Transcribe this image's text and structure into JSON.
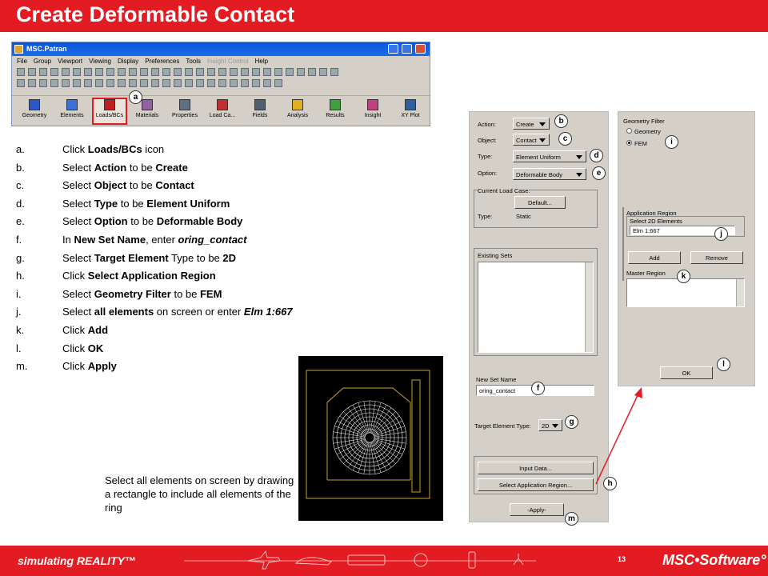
{
  "slide": {
    "title": "Create Deformable Contact",
    "footer_tagline": "simulating REALITY™",
    "page_number": "13",
    "footer_logo": "MSC•Software°",
    "brand_color": "#e31c23"
  },
  "patran": {
    "window_title": "MSC.Patran",
    "menu": [
      "File",
      "Group",
      "Viewport",
      "Viewing",
      "Display",
      "Preferences",
      "Tools",
      "Insight Control",
      "Help"
    ],
    "app_buttons": [
      {
        "label": "Geometry",
        "icon": "cube-icon"
      },
      {
        "label": "Elements",
        "icon": "mesh-cube-icon"
      },
      {
        "label": "Loads/BCs",
        "icon": "load-arrow-icon",
        "selected": true
      },
      {
        "label": "Materials",
        "icon": "materials-icon"
      },
      {
        "label": "Properties",
        "icon": "properties-icon"
      },
      {
        "label": "Load Ca...",
        "icon": "load-cases-icon"
      },
      {
        "label": "Fields",
        "icon": "fields-grid-icon"
      },
      {
        "label": "Analysis",
        "icon": "analysis-bulb-icon"
      },
      {
        "label": "Results",
        "icon": "results-cube-icon"
      },
      {
        "label": "Insight",
        "icon": "insight-icon"
      },
      {
        "label": "XY Plot",
        "icon": "xy-plot-icon"
      }
    ]
  },
  "steps": [
    {
      "letter": "a.",
      "parts": [
        [
          "Click ",
          ""
        ],
        [
          "Loads/BCs",
          "b"
        ],
        [
          " icon",
          ""
        ]
      ]
    },
    {
      "letter": "b.",
      "parts": [
        [
          "Select ",
          ""
        ],
        [
          "Action",
          "b"
        ],
        [
          " to be ",
          ""
        ],
        [
          "Create",
          "b"
        ]
      ]
    },
    {
      "letter": "c.",
      "parts": [
        [
          "Select ",
          ""
        ],
        [
          "Object",
          "b"
        ],
        [
          " to be ",
          ""
        ],
        [
          "Contact",
          "b"
        ]
      ]
    },
    {
      "letter": "d.",
      "parts": [
        [
          "Select ",
          ""
        ],
        [
          "Type",
          "b"
        ],
        [
          " to be ",
          ""
        ],
        [
          "Element Uniform",
          "b"
        ]
      ]
    },
    {
      "letter": "e.",
      "parts": [
        [
          "Select ",
          ""
        ],
        [
          "Option",
          "b"
        ],
        [
          " to be ",
          ""
        ],
        [
          "Deformable Body",
          "b"
        ]
      ]
    },
    {
      "letter": "f.",
      "parts": [
        [
          "In ",
          ""
        ],
        [
          "New Set Name",
          "b"
        ],
        [
          ", enter ",
          ""
        ],
        [
          "oring_contact",
          "bi"
        ]
      ]
    },
    {
      "letter": "g.",
      "parts": [
        [
          "Select ",
          ""
        ],
        [
          "Target Element",
          "b"
        ],
        [
          " Type to be ",
          ""
        ],
        [
          "2D",
          "b"
        ]
      ]
    },
    {
      "letter": "h.",
      "parts": [
        [
          "Click ",
          ""
        ],
        [
          "Select Application Region",
          "b"
        ]
      ]
    },
    {
      "letter": "i.",
      "parts": [
        [
          "Select ",
          ""
        ],
        [
          "Geometry Filter",
          "b"
        ],
        [
          " to be ",
          ""
        ],
        [
          "FEM",
          "b"
        ]
      ]
    },
    {
      "letter": "j.",
      "parts": [
        [
          "Select ",
          ""
        ],
        [
          "all elements",
          "b"
        ],
        [
          " on screen or enter ",
          ""
        ],
        [
          "Elm 1:667",
          "bi"
        ]
      ]
    },
    {
      "letter": "k.",
      "parts": [
        [
          "Click ",
          ""
        ],
        [
          "Add",
          "b"
        ]
      ]
    },
    {
      "letter": "l.",
      "parts": [
        [
          "Click ",
          ""
        ],
        [
          "OK",
          "b"
        ]
      ]
    },
    {
      "letter": "m.",
      "parts": [
        [
          "Click ",
          ""
        ],
        [
          "Apply",
          "b"
        ]
      ]
    }
  ],
  "viewport_note": "Select all elements on screen by drawing a rectangle to include all elements of the ring",
  "form": {
    "action_label": "Action:",
    "action_value": "Create",
    "object_label": "Object:",
    "object_value": "Contact",
    "type_label": "Type:",
    "type_value": "Element Uniform",
    "option_label": "Option:",
    "option_value": "Deformable Body",
    "current_load_case_label": "Current Load Case:",
    "default_button": "Default...",
    "lc_type_label": "Type:",
    "lc_type_value": "Static",
    "existing_sets_label": "Existing Sets",
    "new_set_name_label": "New Set Name",
    "new_set_name_value": "oring_contact",
    "target_type_label": "Target Element Type:",
    "target_type_value": "2D",
    "input_data_button": "Input Data...",
    "select_region_button": "Select Application Region...",
    "apply_button": "-Apply-"
  },
  "region": {
    "geometry_filter_label": "Geometry Filter",
    "geometry_option": "Geometry",
    "fem_option": "FEM",
    "selected_filter": "FEM",
    "application_region_label": "Application Region",
    "select_label": "Select 2D Elements",
    "select_value": "Elm 1:667",
    "add_button": "Add",
    "remove_button": "Remove",
    "master_region_label": "Master Region",
    "ok_button": "OK"
  },
  "callouts": {
    "a": "a",
    "b": "b",
    "c": "c",
    "d": "d",
    "e": "e",
    "f": "f",
    "g": "g",
    "h": "h",
    "i": "i",
    "j": "j",
    "k": "k",
    "l": "l",
    "m": "m"
  }
}
